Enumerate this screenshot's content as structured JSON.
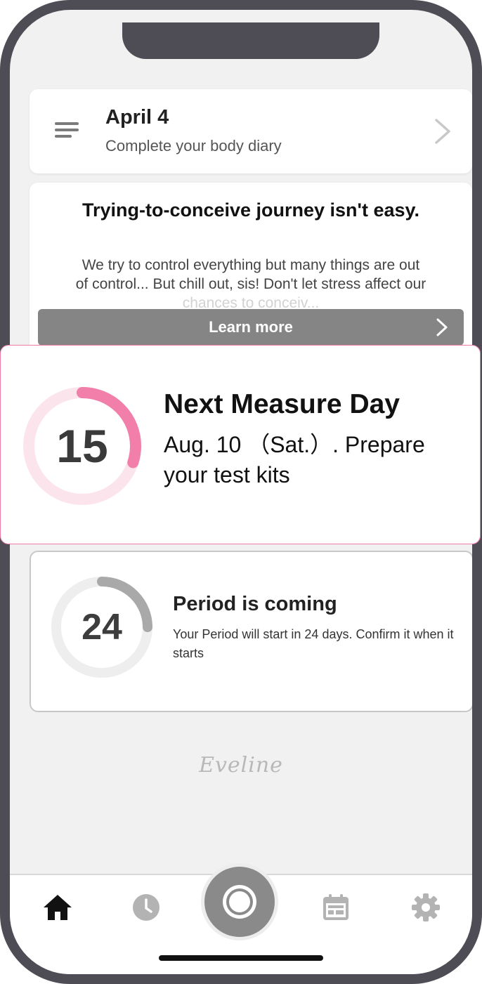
{
  "diary": {
    "date": "April 4",
    "subtitle": "Complete your body diary"
  },
  "article": {
    "title": "Trying-to-conceive journey isn't easy.",
    "body_line1": "We try to control everything but many things are out",
    "body_line2": "of control... But chill out, sis! Don't let stress affect our",
    "body_line3": "chances to conceiv...",
    "button_label": "Learn more"
  },
  "measure": {
    "days": "15",
    "progress": 0.3,
    "title": "Next Measure Day",
    "description": "Aug.  10 （Sat.）. Prepare your test kits"
  },
  "period": {
    "days": "24",
    "progress": 0.25,
    "title": "Period is coming",
    "description": "Your Period will start in 24 days. Confirm it when it starts"
  },
  "logo": "Eveline",
  "tabs": {
    "home": "home-icon",
    "history": "clock-icon",
    "camera": "camera-shutter-icon",
    "calendar": "calendar-icon",
    "settings": "gear-icon"
  },
  "colors": {
    "accent_pink": "#f17fa9",
    "ring_track_pink": "#fce4ec",
    "period_ring": "#a9a9a9",
    "period_track": "#eeeeee"
  }
}
